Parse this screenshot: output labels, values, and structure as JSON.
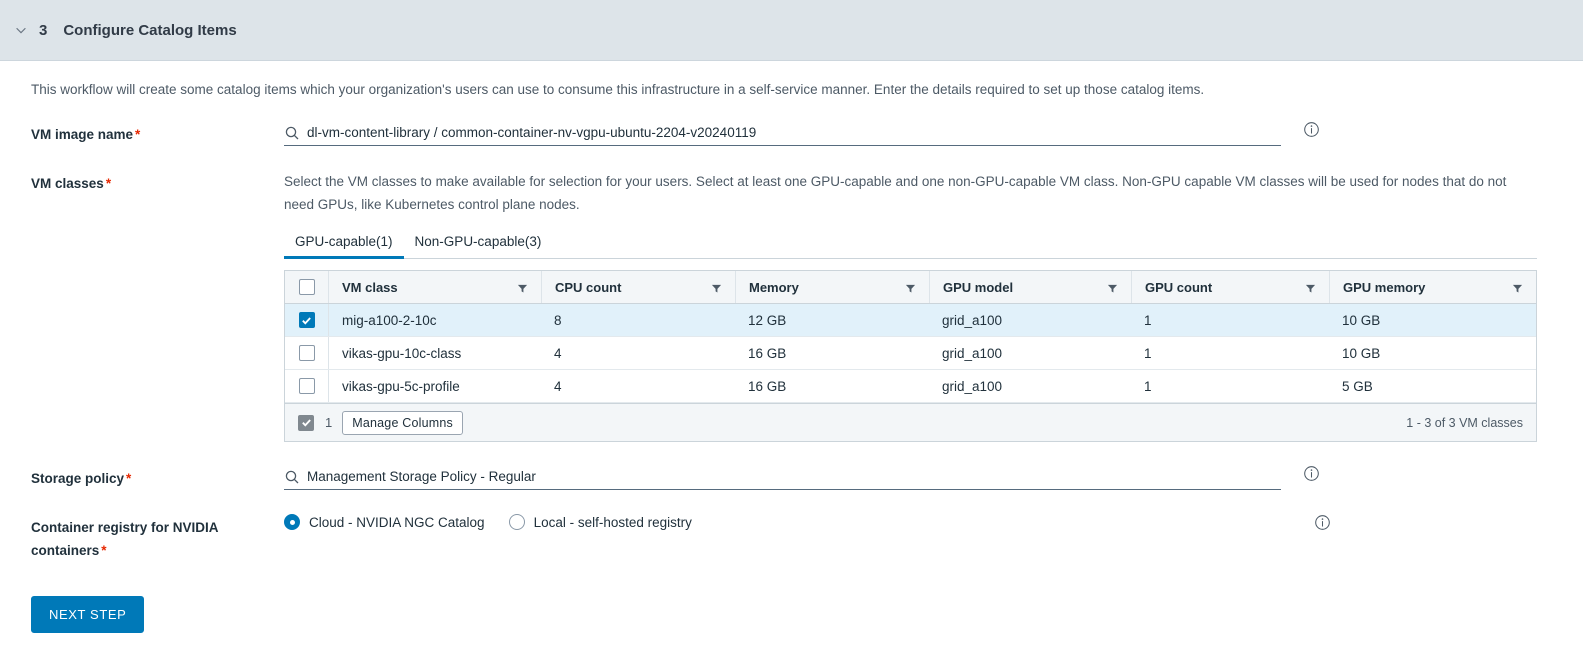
{
  "section": {
    "step_number": "3",
    "title": "Configure Catalog Items",
    "collapse_icon": "chevron-down-icon"
  },
  "intro": "This workflow will create some catalog items which your organization's users can use to consume this infrastructure in a self-service manner. Enter the details required to set up those catalog items.",
  "vm_image": {
    "label": "VM image name",
    "required_marker": "*",
    "value": "dl-vm-content-library / common-container-nv-vgpu-ubuntu-2204-v20240119",
    "search_icon": "search-icon",
    "info_icon": "info-circle-icon"
  },
  "vm_classes": {
    "label": "VM classes",
    "required_marker": "*",
    "helper": "Select the VM classes to make available for selection for your users. Select at least one GPU-capable and one non-GPU-capable VM class. Non-GPU capable VM classes will be used for nodes that do not need GPUs, like Kubernetes control plane nodes.",
    "tabs": [
      {
        "label": "GPU-capable(1)",
        "active": true
      },
      {
        "label": "Non-GPU-capable(3)",
        "active": false
      }
    ],
    "columns": [
      "VM class",
      "CPU count",
      "Memory",
      "GPU model",
      "GPU count",
      "GPU memory"
    ],
    "rows": [
      {
        "selected": true,
        "vm_class": "mig-a100-2-10c",
        "cpu_count": "8",
        "memory": "12 GB",
        "gpu_model": "grid_a100",
        "gpu_count": "1",
        "gpu_memory": "10 GB"
      },
      {
        "selected": false,
        "vm_class": "vikas-gpu-10c-class",
        "cpu_count": "4",
        "memory": "16 GB",
        "gpu_model": "grid_a100",
        "gpu_count": "1",
        "gpu_memory": "10 GB"
      },
      {
        "selected": false,
        "vm_class": "vikas-gpu-5c-profile",
        "cpu_count": "4",
        "memory": "16 GB",
        "gpu_model": "grid_a100",
        "gpu_count": "1",
        "gpu_memory": "5 GB"
      }
    ],
    "footer": {
      "selected_count": "1",
      "manage_columns_label": "Manage Columns",
      "pagination": "1 - 3 of 3 VM classes"
    }
  },
  "storage_policy": {
    "label": "Storage policy",
    "required_marker": "*",
    "value": "Management Storage Policy - Regular",
    "search_icon": "search-icon",
    "info_icon": "info-circle-icon"
  },
  "container_registry": {
    "label_line1": "Container registry for NVIDIA",
    "label_line2": "containers",
    "required_marker": "*",
    "options": [
      {
        "label": "Cloud - NVIDIA NGC Catalog",
        "selected": true
      },
      {
        "label": "Local - self-hosted registry",
        "selected": false
      }
    ],
    "info_icon": "info-circle-icon"
  },
  "next_button": {
    "label": "NEXT STEP"
  },
  "colors": {
    "accent": "#0079b8",
    "header_bg": "#dde4e9",
    "row_selected_bg": "#e1f1fa",
    "required_red": "#e62700",
    "grid_header_bg": "#f3f6f8"
  }
}
